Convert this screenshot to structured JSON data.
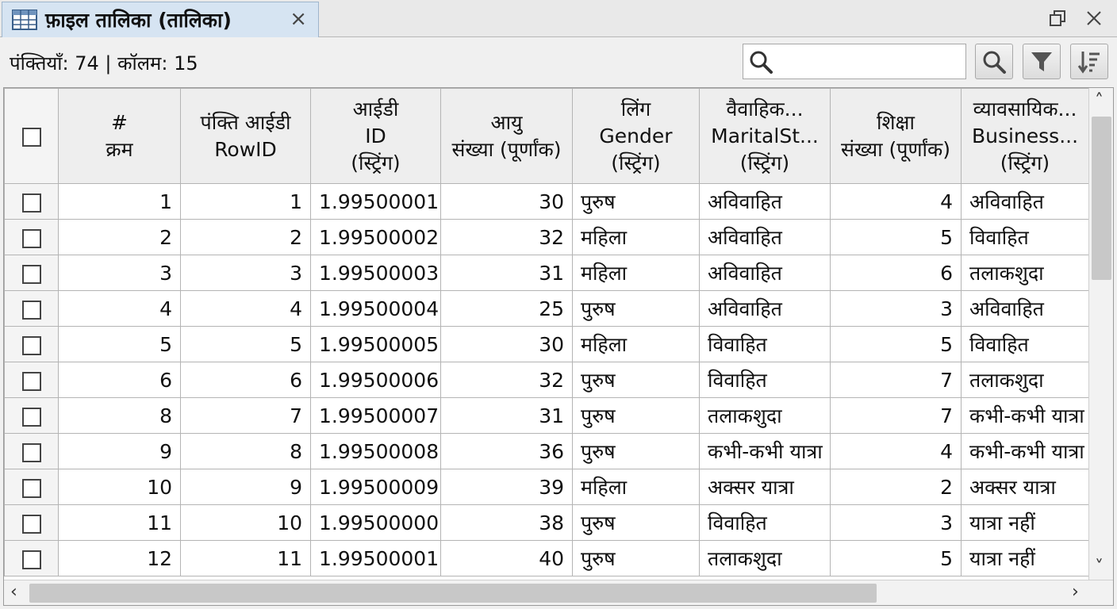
{
  "tab": {
    "title": "फ़ाइल तालिका (तालिका)",
    "close_symbol": "×",
    "icon": "table-icon"
  },
  "window": {
    "restore_icon": "restore-icon",
    "close_symbol": "×"
  },
  "toolbar": {
    "status": "पंक्तियाँ: 74 | कॉलम: 15",
    "search_value": "",
    "buttons": [
      "search-icon",
      "filter-icon",
      "sort-icon"
    ]
  },
  "table": {
    "columns": [
      {
        "line1": "#",
        "line2": "क्रम",
        "line3": ""
      },
      {
        "line1": "पंक्ति आईडी",
        "line2": "RowID",
        "line3": ""
      },
      {
        "line1": "आईडी",
        "line2": "ID",
        "line3": "(स्ट्रिंग)"
      },
      {
        "line1": "आयु",
        "line2": "संख्या (पूर्णांक)",
        "line3": ""
      },
      {
        "line1": "लिंग",
        "line2": "Gender",
        "line3": "(स्ट्रिंग)"
      },
      {
        "line1": "वैवाहिक...",
        "line2": "MaritalSt...",
        "line3": "(स्ट्रिंग)"
      },
      {
        "line1": "शिक्षा",
        "line2": "संख्या (पूर्णांक)",
        "line3": ""
      },
      {
        "line1": "व्यावसायिक...",
        "line2": "Business...",
        "line3": "(स्ट्रिंग)"
      }
    ],
    "rows": [
      [
        "1",
        "1",
        "1.99500001",
        "30",
        "पुरुष",
        "अविवाहित",
        "4",
        "अविवाहित"
      ],
      [
        "2",
        "2",
        "1.99500002",
        "32",
        "महिला",
        "अविवाहित",
        "5",
        "विवाहित"
      ],
      [
        "3",
        "3",
        "1.99500003",
        "31",
        "महिला",
        "अविवाहित",
        "6",
        "तलाकशुदा"
      ],
      [
        "4",
        "4",
        "1.99500004",
        "25",
        "पुरुष",
        "अविवाहित",
        "3",
        "अविवाहित"
      ],
      [
        "5",
        "5",
        "1.99500005",
        "30",
        "महिला",
        "विवाहित",
        "5",
        "विवाहित"
      ],
      [
        "6",
        "6",
        "1.99500006",
        "32",
        "पुरुष",
        "विवाहित",
        "7",
        "तलाकशुदा"
      ],
      [
        "8",
        "7",
        "1.99500007",
        "31",
        "पुरुष",
        "तलाकशुदा",
        "7",
        "कभी-कभी यात्रा"
      ],
      [
        "9",
        "8",
        "1.99500008",
        "36",
        "पुरुष",
        "कभी-कभी यात्रा",
        "4",
        "कभी-कभी यात्रा"
      ],
      [
        "10",
        "9",
        "1.99500009",
        "39",
        "महिला",
        "अक्सर यात्रा",
        "2",
        "अक्सर यात्रा"
      ],
      [
        "11",
        "10",
        "1.99500000",
        "38",
        "पुरुष",
        "विवाहित",
        "3",
        "यात्रा नहीं"
      ],
      [
        "12",
        "11",
        "1.99500001",
        "40",
        "पुरुष",
        "तलाकशुदा",
        "5",
        "यात्रा नहीं"
      ]
    ]
  },
  "scrollbars": {
    "up": "˄",
    "down": "˅",
    "left": "‹",
    "right": "›"
  }
}
